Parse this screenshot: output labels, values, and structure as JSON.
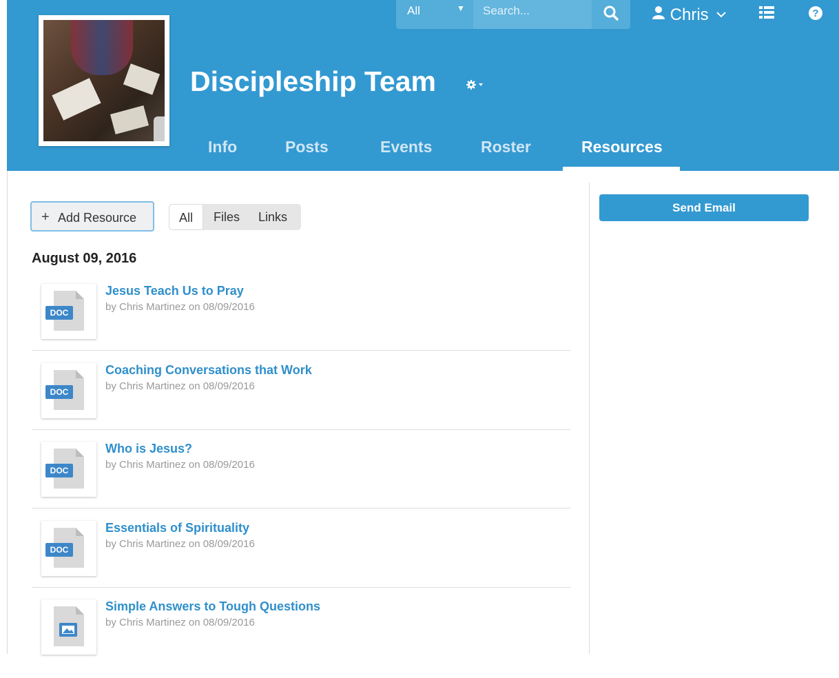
{
  "header": {
    "group_title": "Discipleship Team",
    "search": {
      "scope": "All",
      "placeholder": "Search..."
    },
    "user_name": "Chris",
    "tabs": [
      {
        "label": "Info"
      },
      {
        "label": "Posts"
      },
      {
        "label": "Events"
      },
      {
        "label": "Roster"
      },
      {
        "label": "Resources"
      }
    ],
    "active_tab": "Resources",
    "icons": [
      "gear-icon",
      "search-icon",
      "user-icon",
      "chevron-down-icon",
      "list-icon",
      "help-icon"
    ],
    "colors": {
      "header_bg": "#3399d1"
    }
  },
  "toolbar": {
    "add_resource_label": "Add Resource",
    "filters": [
      {
        "label": "All"
      },
      {
        "label": "Files"
      },
      {
        "label": "Links"
      }
    ],
    "selected_filter": "All"
  },
  "sidebar": {
    "send_email_label": "Send Email"
  },
  "resources": {
    "date_heading": "August 09, 2016",
    "items": [
      {
        "name": "Jesus Teach Us to Pray",
        "meta": "by Chris Martinez on 08/09/2016",
        "icon": "doc-file-icon",
        "tag": "DOC"
      },
      {
        "name": "Coaching Conversations that Work",
        "meta": "by Chris Martinez on 08/09/2016",
        "icon": "doc-file-icon",
        "tag": "DOC"
      },
      {
        "name": "Who is Jesus?",
        "meta": "by Chris Martinez on 08/09/2016",
        "icon": "doc-file-icon",
        "tag": "DOC"
      },
      {
        "name": "Essentials of Spirituality",
        "meta": "by Chris Martinez on 08/09/2016",
        "icon": "doc-file-icon",
        "tag": "DOC"
      },
      {
        "name": "Simple Answers to Tough Questions",
        "meta": "by Chris Martinez on 08/09/2016",
        "icon": "image-file-icon"
      }
    ]
  }
}
